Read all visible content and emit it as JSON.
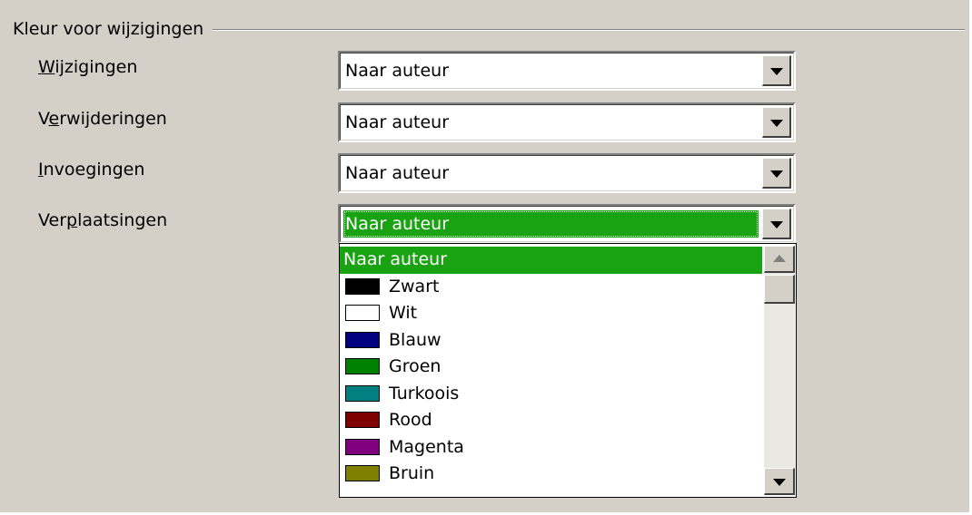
{
  "group": {
    "title": "Kleur voor wijzigingen"
  },
  "rows": [
    {
      "label_accel": "W",
      "label_rest": "ijzigingen",
      "value": "Naar auteur"
    },
    {
      "label_pre": "V",
      "label_accel": "e",
      "label_rest": "rwijderingen",
      "value": "Naar auteur"
    },
    {
      "label_accel": "I",
      "label_rest": "nvoegingen",
      "value": "Naar auteur"
    },
    {
      "label_pre": "Ver",
      "label_accel": "p",
      "label_rest": "laatsingen",
      "value": "Naar auteur"
    }
  ],
  "dropdown": {
    "selected": "Naar auteur",
    "items": [
      {
        "label": "Zwart",
        "color": "#000000"
      },
      {
        "label": "Wit",
        "color": "#ffffff"
      },
      {
        "label": "Blauw",
        "color": "#000080"
      },
      {
        "label": "Groen",
        "color": "#008000"
      },
      {
        "label": "Turkoois",
        "color": "#008080"
      },
      {
        "label": "Rood",
        "color": "#800000"
      },
      {
        "label": "Magenta",
        "color": "#800080"
      },
      {
        "label": "Bruin",
        "color": "#808000"
      }
    ]
  },
  "colors": {
    "highlight": "#19a312",
    "dialog": "#d4d0c8"
  }
}
